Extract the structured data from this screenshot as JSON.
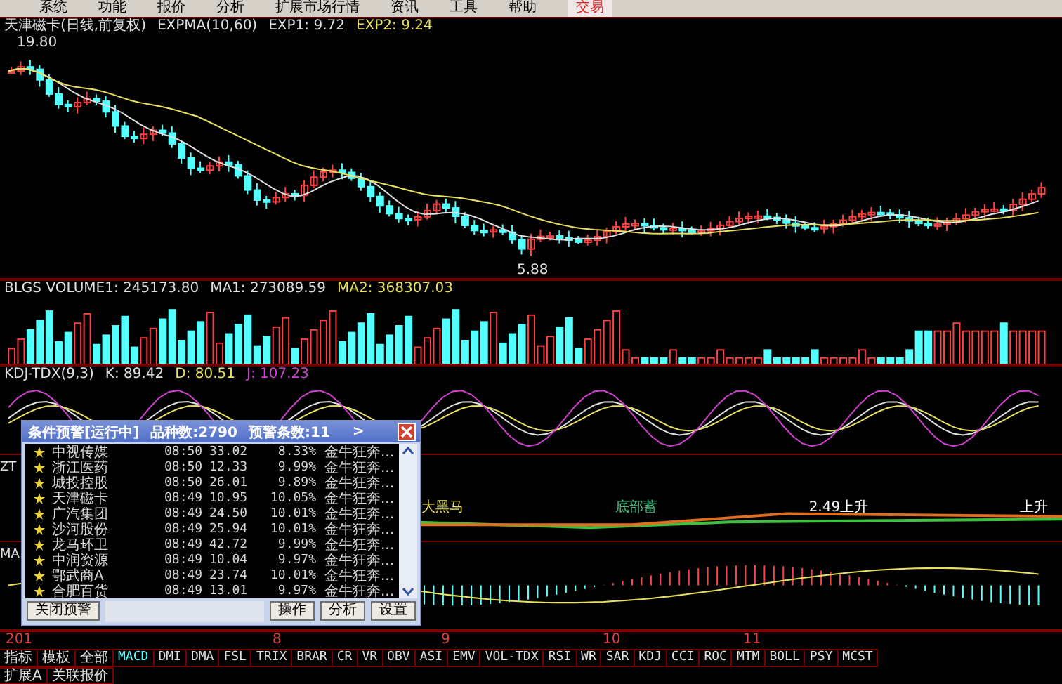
{
  "menu": [
    {
      "label": "系统",
      "selected": false
    },
    {
      "label": "功能",
      "selected": false
    },
    {
      "label": "报价",
      "selected": false
    },
    {
      "label": "分析",
      "selected": false
    },
    {
      "label": "扩展市场行情",
      "selected": false
    },
    {
      "label": "资讯",
      "selected": false
    },
    {
      "label": "工具",
      "selected": false
    },
    {
      "label": "帮助",
      "selected": false
    },
    {
      "label": "交易",
      "selected": true
    }
  ],
  "main_chart": {
    "title": "天津磁卡(日线,前复权)",
    "indicator": "EXPMA(10,60)",
    "values": [
      {
        "label": "EXP1: 9.72",
        "color": "#e0e0e0"
      },
      {
        "label": "EXP2: 9.24",
        "color": "#e8e060"
      }
    ],
    "high_label": "19.80",
    "low_label": "5.88"
  },
  "volume_chart": {
    "values": [
      {
        "label": "BLGS VOLUME1: 245173.80",
        "color": "#e0e0e0"
      },
      {
        "label": "MA1: 273089.59",
        "color": "#e0e0e0"
      },
      {
        "label": "MA2: 368307.03",
        "color": "#e8e060"
      }
    ]
  },
  "kdj_chart": {
    "values": [
      {
        "label": "KDJ-TDX(9,3)",
        "color": "#e0e0e0"
      },
      {
        "label": "K: 89.42",
        "color": "#e0e0e0"
      },
      {
        "label": "D: 80.51",
        "color": "#e8e060"
      },
      {
        "label": "J: 107.23",
        "color": "#d040d0"
      }
    ]
  },
  "signal_chart": {
    "side_label": "ZT",
    "annotations": [
      {
        "label": "大黑马",
        "color": "#e8e060"
      },
      {
        "label": "底部蓄",
        "color": "#40c080"
      },
      {
        "label": "2.49上升",
        "color": "#ffffff"
      },
      {
        "label": "上升",
        "color": "#ffffff"
      }
    ]
  },
  "ma_chart": {
    "side_label": "MA"
  },
  "alert_window": {
    "title": "条件预警[运行中]",
    "count": "品种数:2790",
    "alerts": "预警条数:11",
    "more": ">",
    "rows": [
      {
        "name": "中视传媒",
        "time": "08:50",
        "price": "33.02",
        "change": "8.33%",
        "signal": "金牛狂奔..."
      },
      {
        "name": "浙江医药",
        "time": "08:50",
        "price": "12.33",
        "change": "9.99%",
        "signal": "金牛狂奔..."
      },
      {
        "name": "城投控股",
        "time": "08:50",
        "price": "26.01",
        "change": "9.89%",
        "signal": "金牛狂奔..."
      },
      {
        "name": "天津磁卡",
        "time": "08:49",
        "price": "10.95",
        "change": "10.05%",
        "signal": "金牛狂奔..."
      },
      {
        "name": "广汽集团",
        "time": "08:49",
        "price": "24.50",
        "change": "10.01%",
        "signal": "金牛狂奔..."
      },
      {
        "name": "沙河股份",
        "time": "08:49",
        "price": "25.94",
        "change": "10.01%",
        "signal": "金牛狂奔..."
      },
      {
        "name": "龙马环卫",
        "time": "08:49",
        "price": "42.72",
        "change": "9.99%",
        "signal": "金牛狂奔..."
      },
      {
        "name": "中润资源",
        "time": "08:49",
        "price": "10.04",
        "change": "9.97%",
        "signal": "金牛狂奔..."
      },
      {
        "name": "鄂武商A",
        "time": "08:49",
        "price": "23.74",
        "change": "10.01%",
        "signal": "金牛狂奔..."
      },
      {
        "name": "合肥百货",
        "time": "08:49",
        "price": "13.01",
        "change": "9.97%",
        "signal": "金牛狂奔..."
      }
    ],
    "close_button": "关闭预警",
    "buttons": [
      "操作",
      "分析",
      "设置"
    ]
  },
  "date_axis": [
    "201",
    "8",
    "9",
    "10",
    "11"
  ],
  "indicator_tabs": [
    {
      "label": "指标",
      "kind": "text",
      "selected": false
    },
    {
      "label": "模板",
      "kind": "text",
      "selected": false
    },
    {
      "label": "全部",
      "kind": "text",
      "selected": false
    },
    {
      "label": "MACD",
      "kind": "code",
      "selected": true
    },
    {
      "label": "DMI",
      "kind": "code",
      "selected": false
    },
    {
      "label": "DMA",
      "kind": "code",
      "selected": false
    },
    {
      "label": "FSL",
      "kind": "code",
      "selected": false
    },
    {
      "label": "TRIX",
      "kind": "code",
      "selected": false
    },
    {
      "label": "BRAR",
      "kind": "code",
      "selected": false
    },
    {
      "label": "CR",
      "kind": "code",
      "selected": false
    },
    {
      "label": "VR",
      "kind": "code",
      "selected": false
    },
    {
      "label": "OBV",
      "kind": "code",
      "selected": false
    },
    {
      "label": "ASI",
      "kind": "code",
      "selected": false
    },
    {
      "label": "EMV",
      "kind": "code",
      "selected": false
    },
    {
      "label": "VOL-TDX",
      "kind": "code",
      "selected": false
    },
    {
      "label": "RSI",
      "kind": "code",
      "selected": false
    },
    {
      "label": "WR",
      "kind": "code",
      "selected": false
    },
    {
      "label": "SAR",
      "kind": "code",
      "selected": false
    },
    {
      "label": "KDJ",
      "kind": "code",
      "selected": false
    },
    {
      "label": "CCI",
      "kind": "code",
      "selected": false
    },
    {
      "label": "ROC",
      "kind": "code",
      "selected": false
    },
    {
      "label": "MTM",
      "kind": "code",
      "selected": false
    },
    {
      "label": "BOLL",
      "kind": "code",
      "selected": false
    },
    {
      "label": "PSY",
      "kind": "code",
      "selected": false
    },
    {
      "label": "MCST",
      "kind": "code",
      "selected": false
    }
  ],
  "bottom_tabs": [
    "扩展A",
    "关联报价"
  ]
}
